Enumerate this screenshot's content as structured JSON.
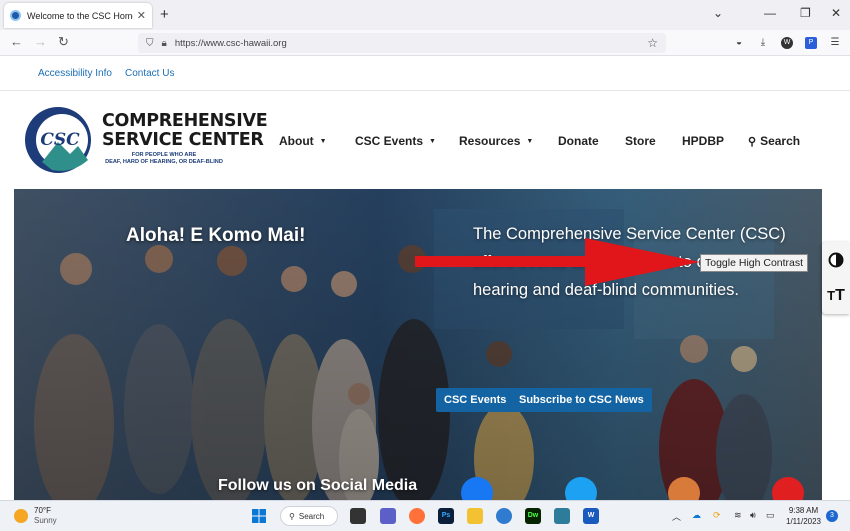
{
  "browser": {
    "tab_title": "Welcome to the CSC Home Pag",
    "url": "https://www.csc-hawaii.org"
  },
  "utility": {
    "accessibility": "Accessibility Info",
    "contact": "Contact Us"
  },
  "logo": {
    "line1": "COMPREHENSIVE",
    "line2": "SERVICE CENTER",
    "sub1": "FOR PEOPLE WHO ARE",
    "sub2": "DEAF, HARD OF HEARING, OR DEAF-BLIND",
    "mark": "CSC"
  },
  "nav": {
    "about": "About",
    "events": "CSC Events",
    "resources": "Resources",
    "donate": "Donate",
    "store": "Store",
    "hpdbp": "HPDBP",
    "search": "Search"
  },
  "hero": {
    "title": "Aloha! E Komo Mai!",
    "text": "The Comprehensive Service Center (CSC) offers events and programs to deaf, hard of hearing and deaf-blind communities.",
    "btn_events": "CSC Events",
    "btn_subscribe": "Subscribe to CSC News",
    "follow": "Follow us on Social Media"
  },
  "widget": {
    "tooltip": "Toggle High Contrast"
  },
  "taskbar": {
    "temp": "70°F",
    "condition": "Sunny",
    "search": "Search",
    "time": "9:38 AM",
    "date": "1/11/2023",
    "notifications": "3"
  },
  "colors": {
    "link": "#1b6fb5",
    "button": "#1464a4",
    "arrow": "#e0161b"
  }
}
